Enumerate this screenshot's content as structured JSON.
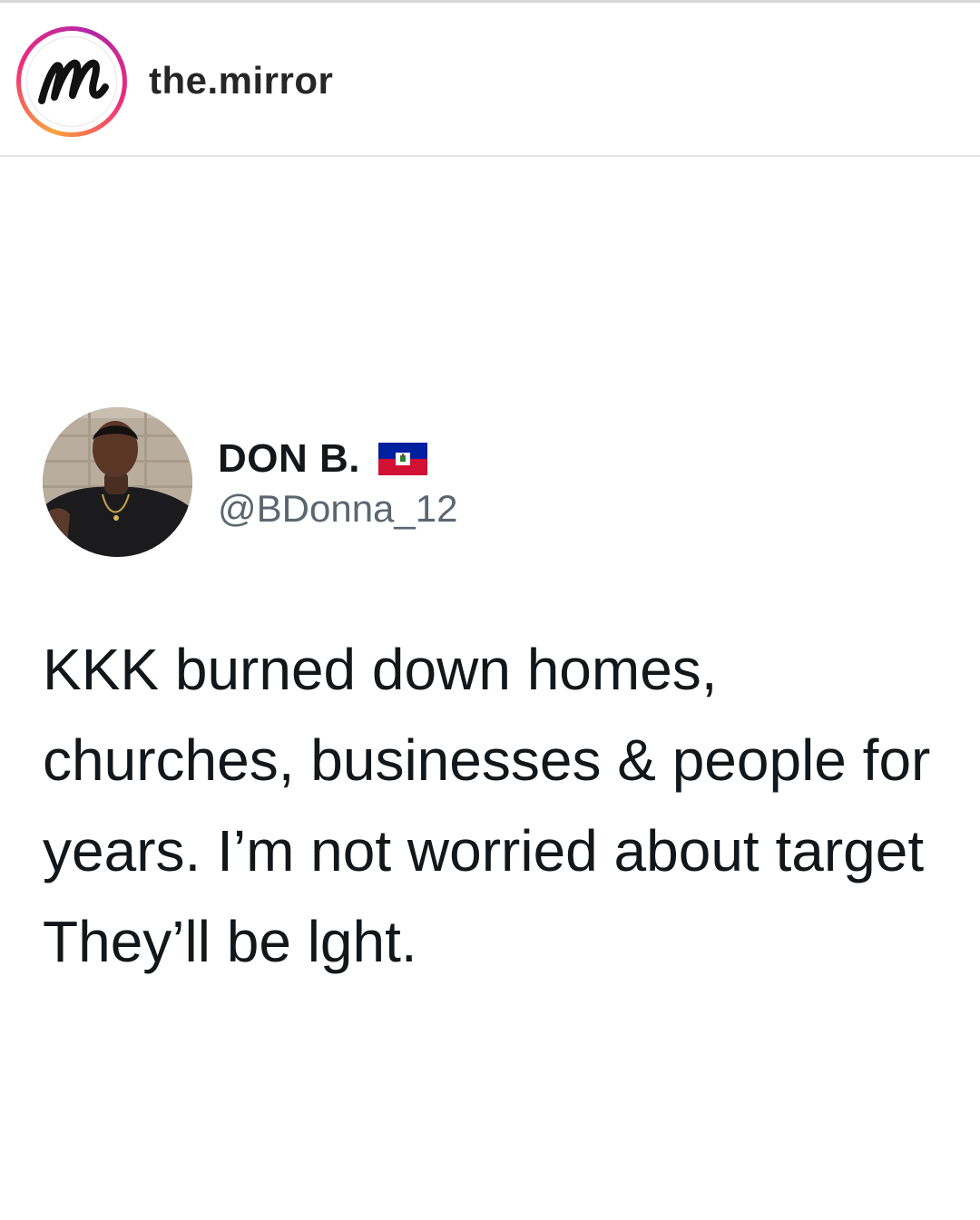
{
  "post": {
    "account_username": "the.mirror",
    "account_avatar_icon": "mirror-m-logo-icon",
    "story_ring_colors": [
      "#f9a43a",
      "#ee2a7b",
      "#b128a9"
    ]
  },
  "tweet": {
    "display_name": "DON B.",
    "flag_icon": "haiti-flag-icon",
    "handle": "@BDonna_12",
    "text_lines": [
      "KKK burned down homes,",
      "churches, businesses & people for",
      "years. I’m not worried about target",
      "They’ll be lght."
    ]
  },
  "colors": {
    "text": "#14171a",
    "handle": "#5b6770",
    "flag_blue": "#00209f",
    "flag_red": "#d21034"
  }
}
